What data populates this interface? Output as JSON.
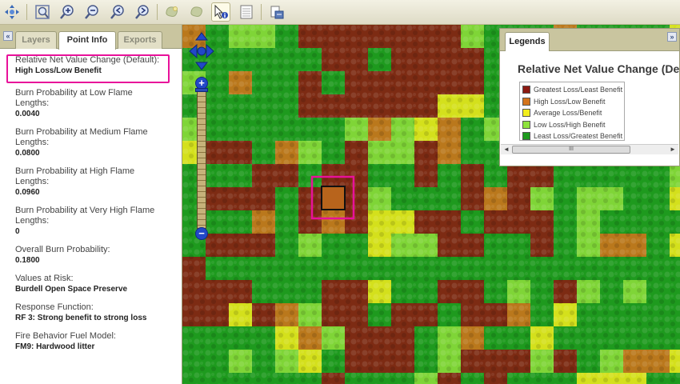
{
  "toolbar": {
    "buttons": [
      {
        "name": "pan-icon"
      },
      {
        "name": "zoom-extent-icon"
      },
      {
        "name": "zoom-in-icon"
      },
      {
        "name": "zoom-out-icon"
      },
      {
        "name": "zoom-previous-icon"
      },
      {
        "name": "zoom-next-icon"
      },
      {
        "name": "select-area-icon"
      },
      {
        "name": "clear-selection-icon"
      },
      {
        "name": "identify-icon"
      },
      {
        "name": "table-icon"
      },
      {
        "name": "export-icon"
      }
    ]
  },
  "left_panel": {
    "collapse_label": "«",
    "tabs": [
      {
        "label": "Layers",
        "active": false
      },
      {
        "label": "Point Info",
        "active": true
      },
      {
        "label": "Exports",
        "active": false
      }
    ],
    "info": [
      {
        "label": "Relative Net Value Change (Default):",
        "value": "High Loss/Low Benefit"
      },
      {
        "label": "Burn Probability at Low Flame Lengths:",
        "value": "0.0040"
      },
      {
        "label": "Burn Probability at Medium Flame Lengths:",
        "value": "0.0800"
      },
      {
        "label": "Burn Probability at High Flame Lengths:",
        "value": "0.0960"
      },
      {
        "label": "Burn Probability at Very High Flame Lengths:",
        "value": "0"
      },
      {
        "label": "Overall Burn Probability:",
        "value": "0.1800"
      },
      {
        "label": "Values at Risk:",
        "value": "Burdell Open Space Preserve"
      },
      {
        "label": "Response Function:",
        "value": "RF 3: Strong benefit to strong loss"
      },
      {
        "label": "Fire Behavior Fuel Model:",
        "value": "FM9: Hardwood litter"
      }
    ]
  },
  "legend_panel": {
    "tab_label": "Legends",
    "expand_label": "»",
    "title": "Relative Net Value Change (De",
    "items": [
      {
        "label": "Greatest Loss/Least Benefit",
        "color": "#8c1a12"
      },
      {
        "label": "High Loss/Low Benefit",
        "color": "#d4741c"
      },
      {
        "label": "Average Loss/Benefit",
        "color": "#f2ee1c"
      },
      {
        "label": "Low Loss/High Benefit",
        "color": "#8ee23c"
      },
      {
        "label": "Least Loss/Greatest Benefit",
        "color": "#1e9a1e"
      }
    ],
    "scroll_left": "◄",
    "scroll_thumb": "III",
    "scroll_right": "►"
  },
  "map": {
    "zoom_in_label": "+",
    "zoom_out_label": "−",
    "selected_cell_color": "#b8641c"
  },
  "colors": {
    "highlight": "#e8119a",
    "panel_tan": "#c9c59f",
    "zoom_blue": "#2248c8"
  }
}
